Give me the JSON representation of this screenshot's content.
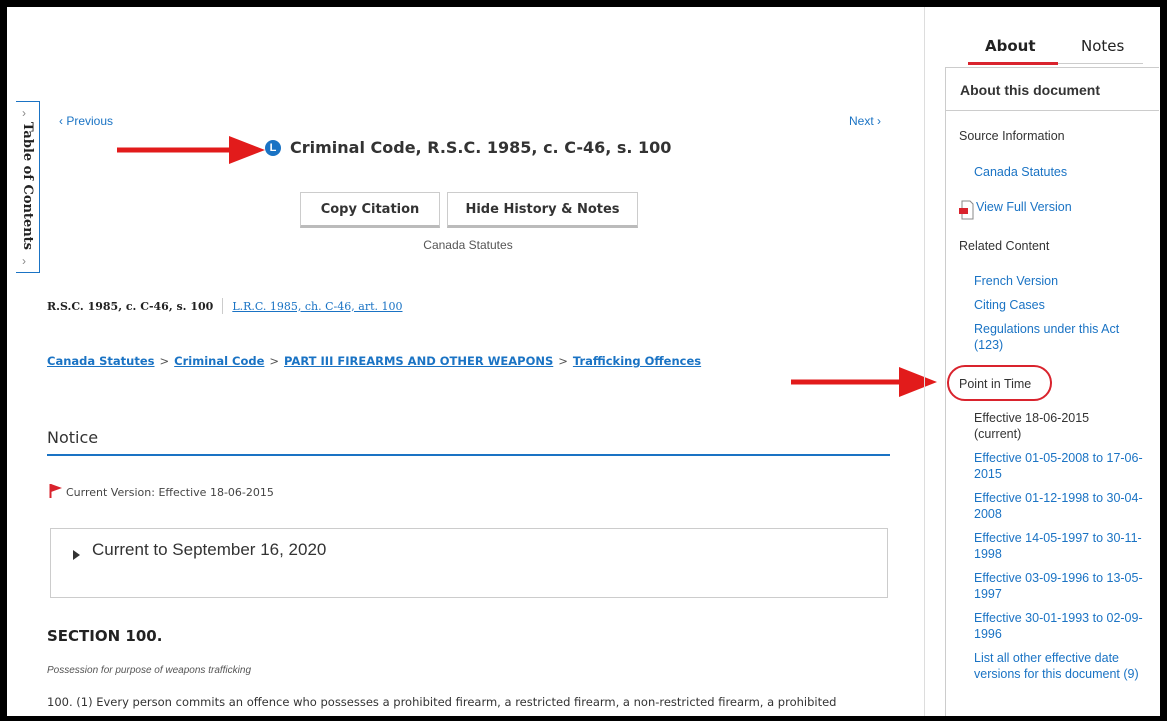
{
  "toc": {
    "label": "Table of Contents"
  },
  "nav": {
    "previous": "‹ Previous",
    "next": "Next ›"
  },
  "document": {
    "badge": "L",
    "title": "Criminal Code, R.S.C. 1985, c. C-46, s. 100",
    "copy_citation_label": "Copy Citation",
    "hide_history_label": "Hide History & Notes",
    "source": "Canada Statutes",
    "citation_en": "R.S.C. 1985, c. C-46, s. 100",
    "citation_fr": "L.R.C. 1985, ch. C-46, art. 100",
    "breadcrumb": [
      "Canada Statutes",
      "Criminal Code",
      "PART III FIREARMS AND OTHER WEAPONS",
      "Trafficking Offences"
    ],
    "breadcrumb_sep": ">",
    "notice_heading": "Notice",
    "current_version": "Current Version: Effective 18-06-2015",
    "current_to": "Current to September 16, 2020",
    "section_heading": "SECTION 100.",
    "section_subtitle": "Possession for purpose of weapons trafficking",
    "section_body": "100. (1) Every person commits an offence who possesses a prohibited firearm, a restricted firearm, a non-restricted firearm, a prohibited"
  },
  "right_panel": {
    "tabs": [
      "About",
      "Notes"
    ],
    "about_heading": "About this document",
    "source_information_label": "Source Information",
    "source_link": "Canada Statutes",
    "view_full_version": "View Full Version",
    "related_content_label": "Related Content",
    "related_links": [
      "French Version",
      "Citing Cases",
      "Regulations under this Act (123)"
    ],
    "point_in_time_label": "Point in Time",
    "current_effective": "Effective 18-06-2015 (current)",
    "versions": [
      "Effective 01-05-2008 to 17-06-2015",
      "Effective 01-12-1998 to 30-04-2008",
      "Effective 14-05-1997 to 30-11-1998",
      "Effective 03-09-1996 to 13-05-1997",
      "Effective 30-01-1993 to 02-09-1996"
    ],
    "list_all": "List all other effective date versions for this document (9)"
  },
  "colors": {
    "accent": "#1a73c4",
    "annotation_red": "#d9232d"
  }
}
